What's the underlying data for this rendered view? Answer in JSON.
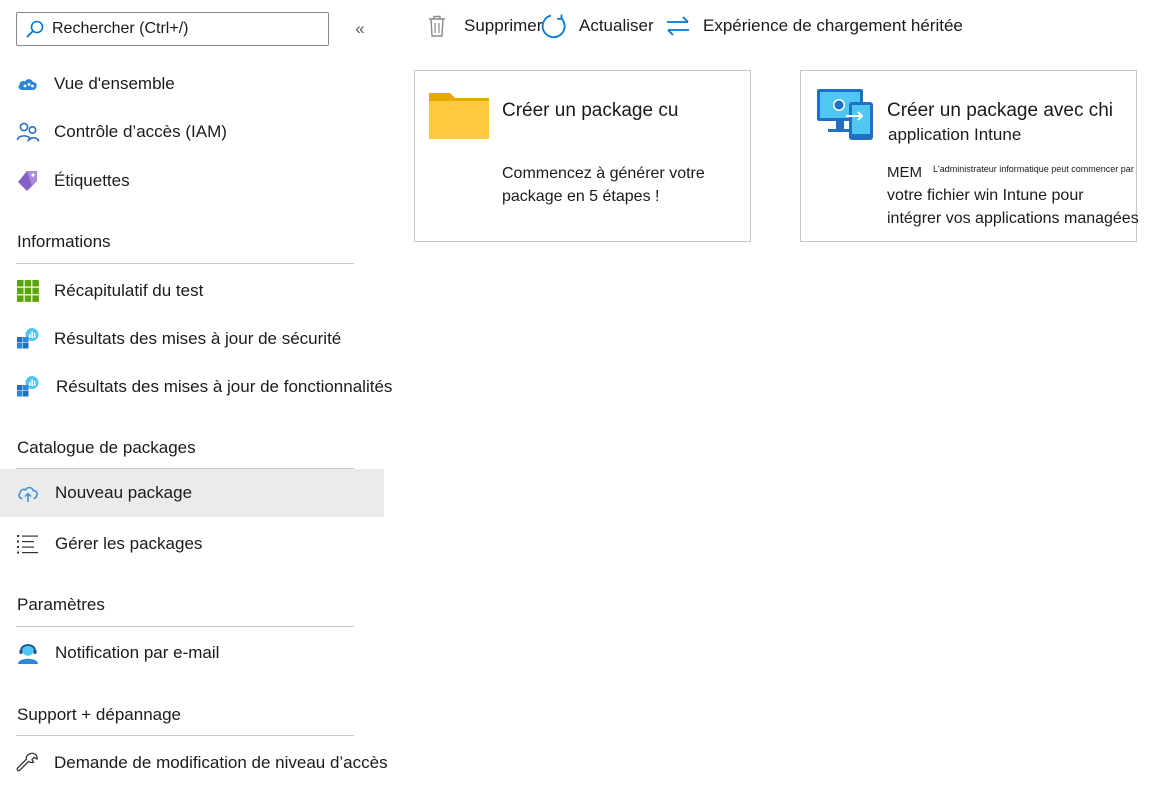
{
  "search": {
    "placeholder": "Rechercher (Ctrl+/)"
  },
  "sidebar": {
    "collapse_label": "«",
    "items_top": [
      {
        "label": "Vue d'ensemble",
        "icon": "cloud-overview-icon"
      },
      {
        "label": "Contrôle d’accès (IAM)",
        "icon": "people-icon"
      },
      {
        "label": "Étiquettes",
        "icon": "tag-icon"
      }
    ],
    "sections": [
      {
        "title": "Informations",
        "items": [
          {
            "label": "Récapitulatif du test",
            "icon": "grid-summary-icon"
          },
          {
            "label": "Résultats des mises à jour de sécurité",
            "icon": "chart-cubes-icon"
          },
          {
            "label": "Résultats des mises à jour de fonctionnalités",
            "icon": "chart-cubes-icon"
          }
        ]
      },
      {
        "title": "Catalogue de packages",
        "items": [
          {
            "label": "Nouveau package",
            "icon": "cloud-upload-icon",
            "selected": true
          },
          {
            "label": "Gérer les packages",
            "icon": "list-icon"
          }
        ]
      },
      {
        "title": "Paramètres",
        "items": [
          {
            "label": "Notification par e-mail",
            "icon": "person-headset-icon"
          }
        ]
      },
      {
        "title": "Support + dépannage",
        "items": [
          {
            "label": "Demande de modification de niveau d’accès",
            "icon": "wrench-icon"
          }
        ]
      }
    ]
  },
  "toolbar": {
    "delete_label": "Supprimer",
    "refresh_label": "Actualiser",
    "legacy_label": "Expérience de chargement héritée"
  },
  "cards": [
    {
      "title": "Créer un package cu",
      "description": "Commencez à générer votre package en 5 étapes !",
      "icon": "folder-icon"
    },
    {
      "title_line1": "Créer un package avec chi",
      "title_line2": "application Intune",
      "mem": "MEM",
      "small_note": "L'administrateur informatique peut commencer par",
      "desc_line1": "votre fichier win Intune pour",
      "desc_line2": "intégrer vos applications managées",
      "icon": "monitor-device-icon"
    }
  ],
  "colors": {
    "accent": "#0078d4",
    "selected_bg": "#ebebeb",
    "divider": "#c8c8c8",
    "folder": "#ffc83d"
  }
}
